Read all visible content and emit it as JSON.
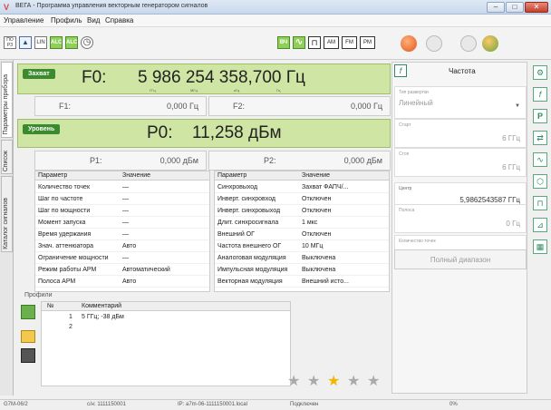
{
  "window": {
    "title": "ВЕГА - Программа управления векторным генератором сигналов"
  },
  "menu": [
    "Управление",
    "Профиль",
    "Вид",
    "Справка"
  ],
  "toolbar": {
    "left": [
      {
        "icon": "preset-icon",
        "label": "ПО\nРЗ"
      },
      {
        "icon": "thumb-icon",
        "label": "▲"
      },
      {
        "icon": "lin-icon",
        "label": "LIN"
      },
      {
        "icon": "alc-on-icon",
        "label": "ALC"
      },
      {
        "icon": "alc-off-icon",
        "label": "ALC"
      },
      {
        "icon": "clock-icon",
        "label": "◷"
      }
    ],
    "mod": [
      {
        "icon": "rf-on-icon",
        "label": "ВЧ"
      },
      {
        "icon": "wave-icon",
        "label": "∿"
      },
      {
        "icon": "pulse-icon",
        "label": "⊓"
      },
      {
        "icon": "am-icon",
        "label": "AM"
      },
      {
        "icon": "fm-icon",
        "label": "FM"
      },
      {
        "icon": "pm-icon",
        "label": "PM"
      }
    ]
  },
  "side_tabs": [
    "Параметры прибора",
    "Список",
    "Каталог сигналов"
  ],
  "capture": {
    "badge": "Захват",
    "f0_label": "F0:",
    "f0_value": "5 986 254 358,700 Гц",
    "f0_units": [
      "ГГц",
      "МГц",
      "кГц",
      "Гц"
    ],
    "f1_label": "F1:",
    "f1_value": "0,000 Гц",
    "f2_label": "F2:",
    "f2_value": "0,000 Гц"
  },
  "level": {
    "badge": "Уровень",
    "p0_label": "P0:",
    "p0_value": "11,258 дБм",
    "p1_label": "P1:",
    "p1_value": "0,000 дБм",
    "p2_label": "P2:",
    "p2_value": "0,000 дБм"
  },
  "params_left": {
    "head": [
      "Параметр",
      "Значение"
    ],
    "rows": [
      [
        "Количество точек",
        "—"
      ],
      [
        "Шаг по частоте",
        "—"
      ],
      [
        "Шаг по мощности",
        "—"
      ],
      [
        "Момент запуска",
        "—"
      ],
      [
        "Время удержания",
        "—"
      ],
      [
        "Знач. аттенюатора",
        "Авто"
      ],
      [
        "Ограничение мощности",
        "—"
      ],
      [
        "Режим работы АРМ",
        "Автоматический"
      ],
      [
        "Полоса АРМ",
        "Авто"
      ]
    ]
  },
  "params_right": {
    "head": [
      "Параметр",
      "Значение"
    ],
    "rows": [
      [
        "Синхровыход",
        "Захват ФАПЧ/..."
      ],
      [
        "Инверт. синхровход",
        "Отключен"
      ],
      [
        "Инверт. синхровыход",
        "Отключен"
      ],
      [
        "Длит. синхросигнала",
        "1 мкс"
      ],
      [
        "Внешний ОГ",
        "Отключен"
      ],
      [
        "Частота внешнего ОГ",
        "10 МГц"
      ],
      [
        "Аналоговая модуляция",
        "Выключена"
      ],
      [
        "Импульсная модуляция",
        "Выключена"
      ],
      [
        "Векторная модуляция",
        "Внешний исто..."
      ]
    ]
  },
  "profiles": {
    "title": "Профили",
    "head": [
      "№",
      "Комментарий"
    ],
    "rows": [
      {
        "num": "1",
        "comment": "5 ГГц; -38 дБм"
      },
      {
        "num": "2",
        "comment": ""
      }
    ],
    "stars": [
      false,
      false,
      true,
      false,
      false
    ]
  },
  "right_panel": {
    "title": "Частота",
    "sweep_type_label": "Тип развертки",
    "sweep_type_value": "Линейный",
    "start_label": "Старт",
    "start_value": "6 ГГц",
    "stop_label": "Стоп",
    "stop_value": "6 ГГц",
    "center_label": "Центр",
    "center_value": "5,9862543587 ГГц",
    "span_label": "Полоса",
    "span_value": "0 Гц",
    "points_label": "Количество точек",
    "points_value": "5",
    "full_range_label": "Полный диапазон"
  },
  "status": {
    "device": "G7М-06/2",
    "serial": "с/н: 1111150001",
    "ip": "IP: a7m-06-1111150001.local",
    "state": "Подключен",
    "progress": "0%"
  }
}
